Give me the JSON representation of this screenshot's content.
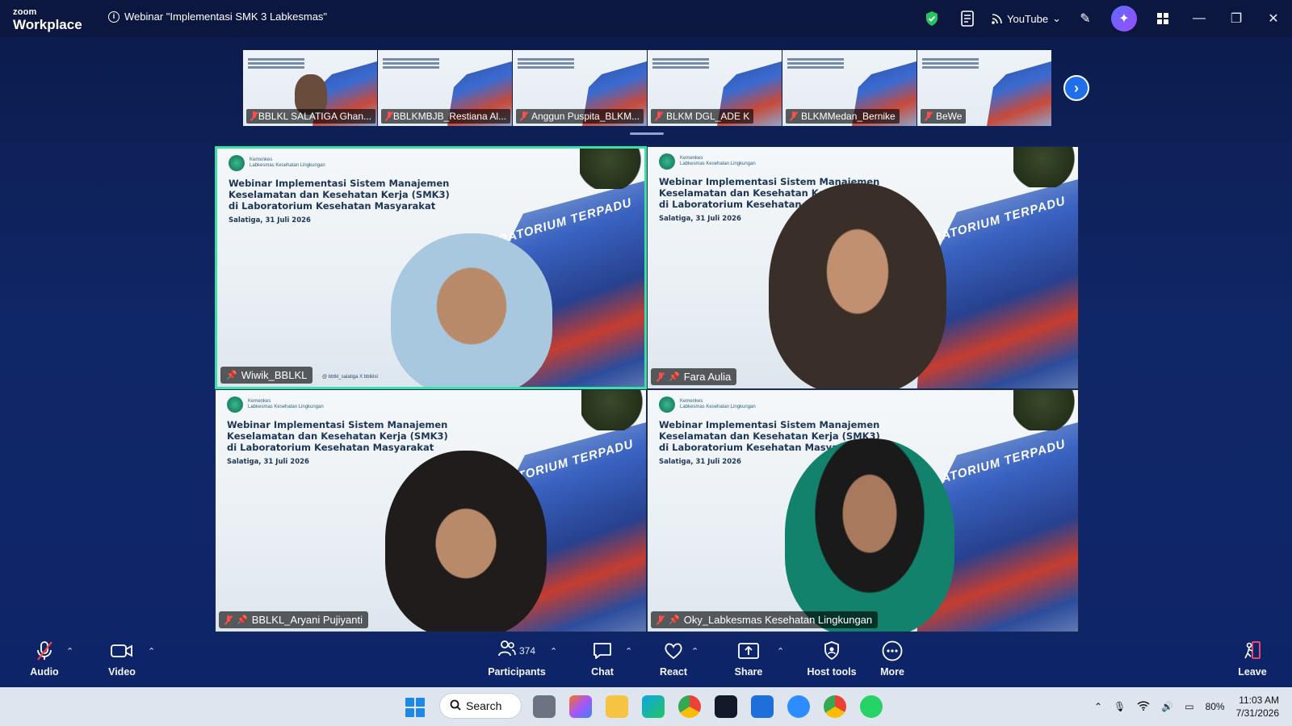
{
  "app": {
    "brand_top": "zoom",
    "brand_bottom": "Workplace",
    "meeting_title": "Webinar \"Implementasi SMK 3 Labkesmas\""
  },
  "titlebar": {
    "icons": [
      "security-shield-icon",
      "notes-icon",
      "live-stream-icon",
      "pen-icon",
      "ai-companion-icon",
      "apps-icon"
    ],
    "stream_label": "YouTube",
    "colors": {
      "shield": "#22c55e"
    }
  },
  "filmstrip": {
    "participants": [
      {
        "name": "BBLKL SALATIGA Ghan..."
      },
      {
        "name": "BBLKMBJB_Restiana Al..."
      },
      {
        "name": "Anggun Puspita_BLKM..."
      },
      {
        "name": "BLKM DGL_ADE K"
      },
      {
        "name": "BLKMMedan_Bernike"
      },
      {
        "name": "BeWe"
      }
    ]
  },
  "slide": {
    "org_line1": "Kemenkes",
    "org_line2": "Labkesmas Kesehatan Lingkungan",
    "heading": "Webinar Implementasi Sistem Manajemen Keselamatan dan Kesehatan Kerja (SMK3) di Laboratorium Kesehatan Masyarakat",
    "date": "Salatiga, 31 Juli 2026",
    "building_sign": "LABORATORIUM TERPADU",
    "socials": "@ bbtkl_salatiga   X bbtklsl"
  },
  "gallery": {
    "tiles": [
      {
        "name": "Wiwik_BBLKL",
        "active": true
      },
      {
        "name": "Fara Aulia",
        "active": false
      },
      {
        "name": "BBLKL_Aryani Pujiyanti",
        "active": false
      },
      {
        "name": "Oky_Labkesmas Kesehatan Lingkungan",
        "active": false
      }
    ],
    "active_color": "#3be0a7"
  },
  "toolbar": {
    "audio": "Audio",
    "video": "Video",
    "participants": "Participants",
    "participants_count": "374",
    "chat": "Chat",
    "react": "React",
    "share": "Share",
    "host_tools": "Host tools",
    "more": "More",
    "leave": "Leave"
  },
  "taskbar": {
    "search_label": "Search",
    "battery": "80%",
    "time": "11:03 AM",
    "date": "7/31/2026"
  }
}
